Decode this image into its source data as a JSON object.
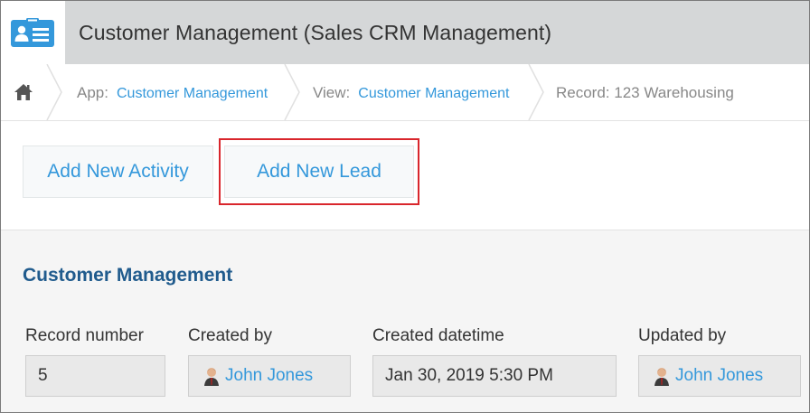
{
  "header": {
    "app_icon": "customer-card-icon",
    "title": "Customer Management (Sales CRM Management)"
  },
  "breadcrumb": {
    "home_icon": "home-icon",
    "app_prefix": "App:",
    "app_link": "Customer Management",
    "view_prefix": "View:",
    "view_link": "Customer Management",
    "record": "Record: 123 Warehousing"
  },
  "actions": {
    "add_activity": "Add New Activity",
    "add_lead": "Add New Lead"
  },
  "record": {
    "section_title": "Customer Management",
    "fields": [
      {
        "label": "Record number",
        "value": "5"
      },
      {
        "label": "Created by",
        "value": "John Jones"
      },
      {
        "label": "Created datetime",
        "value": "Jan 30, 2019 5:30 PM"
      },
      {
        "label": "Updated by",
        "value": "John Jones"
      }
    ]
  },
  "colors": {
    "link": "#3498db",
    "highlight": "#d9262c",
    "section_title": "#205b8d",
    "header_bg": "#d5d7d8"
  }
}
